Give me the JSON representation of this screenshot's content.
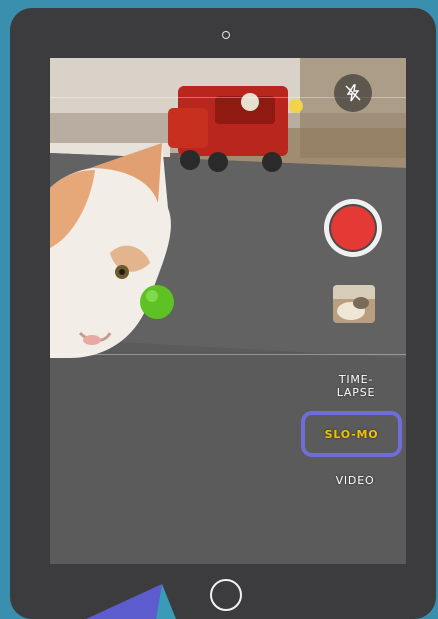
{
  "camera": {
    "modes": {
      "timelapse": "TIME-LAPSE",
      "timelapse_line1": "TIME-",
      "timelapse_line2": "LAPSE",
      "slomo": "SLO-MO",
      "video": "VIDEO"
    },
    "selected_mode": "SLO-MO",
    "colors": {
      "shutter": "#e53935",
      "selected_mode_text": "#f2c200",
      "highlight_box": "#6f6ed8",
      "tablet_bezel": "#3c3c3e",
      "background": "#3b8fae"
    },
    "icons": [
      "flash-off-icon",
      "shutter-button",
      "last-photo-thumbnail",
      "home-button",
      "front-camera"
    ]
  }
}
